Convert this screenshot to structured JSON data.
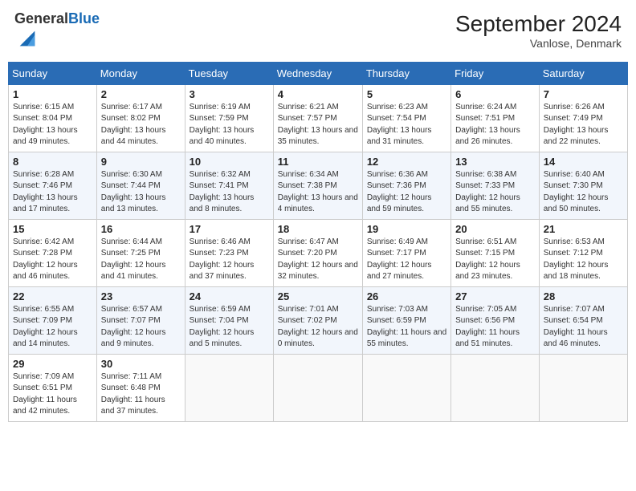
{
  "header": {
    "logo_general": "General",
    "logo_blue": "Blue",
    "month_title": "September 2024",
    "location": "Vanlose, Denmark"
  },
  "days_of_week": [
    "Sunday",
    "Monday",
    "Tuesday",
    "Wednesday",
    "Thursday",
    "Friday",
    "Saturday"
  ],
  "weeks": [
    [
      {
        "day": "1",
        "sunrise": "6:15 AM",
        "sunset": "8:04 PM",
        "daylight": "13 hours and 49 minutes."
      },
      {
        "day": "2",
        "sunrise": "6:17 AM",
        "sunset": "8:02 PM",
        "daylight": "13 hours and 44 minutes."
      },
      {
        "day": "3",
        "sunrise": "6:19 AM",
        "sunset": "7:59 PM",
        "daylight": "13 hours and 40 minutes."
      },
      {
        "day": "4",
        "sunrise": "6:21 AM",
        "sunset": "7:57 PM",
        "daylight": "13 hours and 35 minutes."
      },
      {
        "day": "5",
        "sunrise": "6:23 AM",
        "sunset": "7:54 PM",
        "daylight": "13 hours and 31 minutes."
      },
      {
        "day": "6",
        "sunrise": "6:24 AM",
        "sunset": "7:51 PM",
        "daylight": "13 hours and 26 minutes."
      },
      {
        "day": "7",
        "sunrise": "6:26 AM",
        "sunset": "7:49 PM",
        "daylight": "13 hours and 22 minutes."
      }
    ],
    [
      {
        "day": "8",
        "sunrise": "6:28 AM",
        "sunset": "7:46 PM",
        "daylight": "13 hours and 17 minutes."
      },
      {
        "day": "9",
        "sunrise": "6:30 AM",
        "sunset": "7:44 PM",
        "daylight": "13 hours and 13 minutes."
      },
      {
        "day": "10",
        "sunrise": "6:32 AM",
        "sunset": "7:41 PM",
        "daylight": "13 hours and 8 minutes."
      },
      {
        "day": "11",
        "sunrise": "6:34 AM",
        "sunset": "7:38 PM",
        "daylight": "13 hours and 4 minutes."
      },
      {
        "day": "12",
        "sunrise": "6:36 AM",
        "sunset": "7:36 PM",
        "daylight": "12 hours and 59 minutes."
      },
      {
        "day": "13",
        "sunrise": "6:38 AM",
        "sunset": "7:33 PM",
        "daylight": "12 hours and 55 minutes."
      },
      {
        "day": "14",
        "sunrise": "6:40 AM",
        "sunset": "7:30 PM",
        "daylight": "12 hours and 50 minutes."
      }
    ],
    [
      {
        "day": "15",
        "sunrise": "6:42 AM",
        "sunset": "7:28 PM",
        "daylight": "12 hours and 46 minutes."
      },
      {
        "day": "16",
        "sunrise": "6:44 AM",
        "sunset": "7:25 PM",
        "daylight": "12 hours and 41 minutes."
      },
      {
        "day": "17",
        "sunrise": "6:46 AM",
        "sunset": "7:23 PM",
        "daylight": "12 hours and 37 minutes."
      },
      {
        "day": "18",
        "sunrise": "6:47 AM",
        "sunset": "7:20 PM",
        "daylight": "12 hours and 32 minutes."
      },
      {
        "day": "19",
        "sunrise": "6:49 AM",
        "sunset": "7:17 PM",
        "daylight": "12 hours and 27 minutes."
      },
      {
        "day": "20",
        "sunrise": "6:51 AM",
        "sunset": "7:15 PM",
        "daylight": "12 hours and 23 minutes."
      },
      {
        "day": "21",
        "sunrise": "6:53 AM",
        "sunset": "7:12 PM",
        "daylight": "12 hours and 18 minutes."
      }
    ],
    [
      {
        "day": "22",
        "sunrise": "6:55 AM",
        "sunset": "7:09 PM",
        "daylight": "12 hours and 14 minutes."
      },
      {
        "day": "23",
        "sunrise": "6:57 AM",
        "sunset": "7:07 PM",
        "daylight": "12 hours and 9 minutes."
      },
      {
        "day": "24",
        "sunrise": "6:59 AM",
        "sunset": "7:04 PM",
        "daylight": "12 hours and 5 minutes."
      },
      {
        "day": "25",
        "sunrise": "7:01 AM",
        "sunset": "7:02 PM",
        "daylight": "12 hours and 0 minutes."
      },
      {
        "day": "26",
        "sunrise": "7:03 AM",
        "sunset": "6:59 PM",
        "daylight": "11 hours and 55 minutes."
      },
      {
        "day": "27",
        "sunrise": "7:05 AM",
        "sunset": "6:56 PM",
        "daylight": "11 hours and 51 minutes."
      },
      {
        "day": "28",
        "sunrise": "7:07 AM",
        "sunset": "6:54 PM",
        "daylight": "11 hours and 46 minutes."
      }
    ],
    [
      {
        "day": "29",
        "sunrise": "7:09 AM",
        "sunset": "6:51 PM",
        "daylight": "11 hours and 42 minutes."
      },
      {
        "day": "30",
        "sunrise": "7:11 AM",
        "sunset": "6:48 PM",
        "daylight": "11 hours and 37 minutes."
      },
      null,
      null,
      null,
      null,
      null
    ]
  ],
  "labels": {
    "sunrise": "Sunrise:",
    "sunset": "Sunset:",
    "daylight": "Daylight:"
  }
}
